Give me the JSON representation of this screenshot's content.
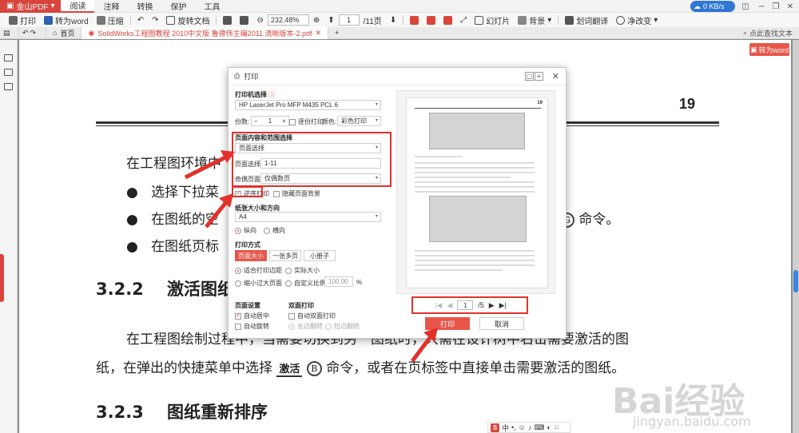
{
  "colors": {
    "accent": "#e8564a",
    "brand": "#d9453c",
    "annot": "#e2312b"
  },
  "menubar": {
    "app": "金山PDF",
    "items": [
      "阅读",
      "注释",
      "转换",
      "保护",
      "工具"
    ],
    "net": "0 KB/s"
  },
  "toolbar": {
    "print": "打印",
    "to_word": "转为word",
    "compress": "压缩",
    "rotate": "旋转文档",
    "zoom": "232.48%",
    "page": "1",
    "page_total": "/11页",
    "slideshow": "幻灯片",
    "background": "背景",
    "translate": "划词翻译",
    "eye": "净改变"
  },
  "tabs": {
    "home": "首页",
    "doc": "SolidWorks工程图教程 2010中文版 鲁德伟主编2011 清晰版本-2.pdf",
    "search": "点此查找文本"
  },
  "page": {
    "num": "19",
    "to_word": "转为word",
    "l1": "在工程图环境中",
    "b1": "选择下拉菜",
    "b2": "在图纸的空",
    "b2_tail": "命令。",
    "b3": "在图纸页标",
    "h1_num": "3.2.2",
    "h1": "激活图纸",
    "p2a": "在工程图绘制过程中，当需要切换到另一图纸时，只需在设计树中右击需要激活的图",
    "p2b_1": "纸，在弹出的快捷菜单中选择",
    "p2b_btn": "激活",
    "p2b_key": "B",
    "p2b_2": "命令，或者在页标签中直接单击需要激活的图纸。",
    "h2_num": "3.2.3",
    "h2": "图纸重新排序",
    "ime": "中"
  },
  "dialog": {
    "title": "打印",
    "printer_label": "打印机选择",
    "printer": "HP LaserJet Pro MFP M435 PCL 6",
    "copies_label": "份数:",
    "copies": "1",
    "collate_label": "逐份打印",
    "color_label": "颜色:",
    "color": "彩色打印",
    "range_title": "页面内容和范围选择",
    "content": "页面选择",
    "range_label": "页面选择：",
    "range": "1-11",
    "odd_even_label": "奇偶页面：",
    "odd_even": "仅偶数页",
    "reverse_label": "逆序打印",
    "hide_bg_label": "隐藏页面背景",
    "paper_title": "纸张大小和方向",
    "paper": "A4",
    "portrait": "纵向",
    "landscape": "横向",
    "mode_title": "打印方式",
    "mode_actual": "页面大小",
    "mode_multi": "一张多页",
    "mode_booklet": "小册子",
    "fit": "适合打印边距",
    "actual": "实际大小",
    "shrink": "缩小过大页面",
    "custom": "自定义比例：",
    "scale": "100.00",
    "pct": "%",
    "pagesetup_title": "页面设置",
    "center": "自动居中",
    "autorotate": "自动旋转",
    "duplex_title": "双面打印",
    "duplex": "自动双面打印",
    "long_edge": "长边翻转",
    "short_edge": "短边翻转",
    "preview_page": "1",
    "preview_total": "/5",
    "print_btn": "打印",
    "cancel_btn": "取消"
  },
  "watermark": {
    "logo": "Bai经验",
    "url": "jingyan.baidu.com"
  }
}
